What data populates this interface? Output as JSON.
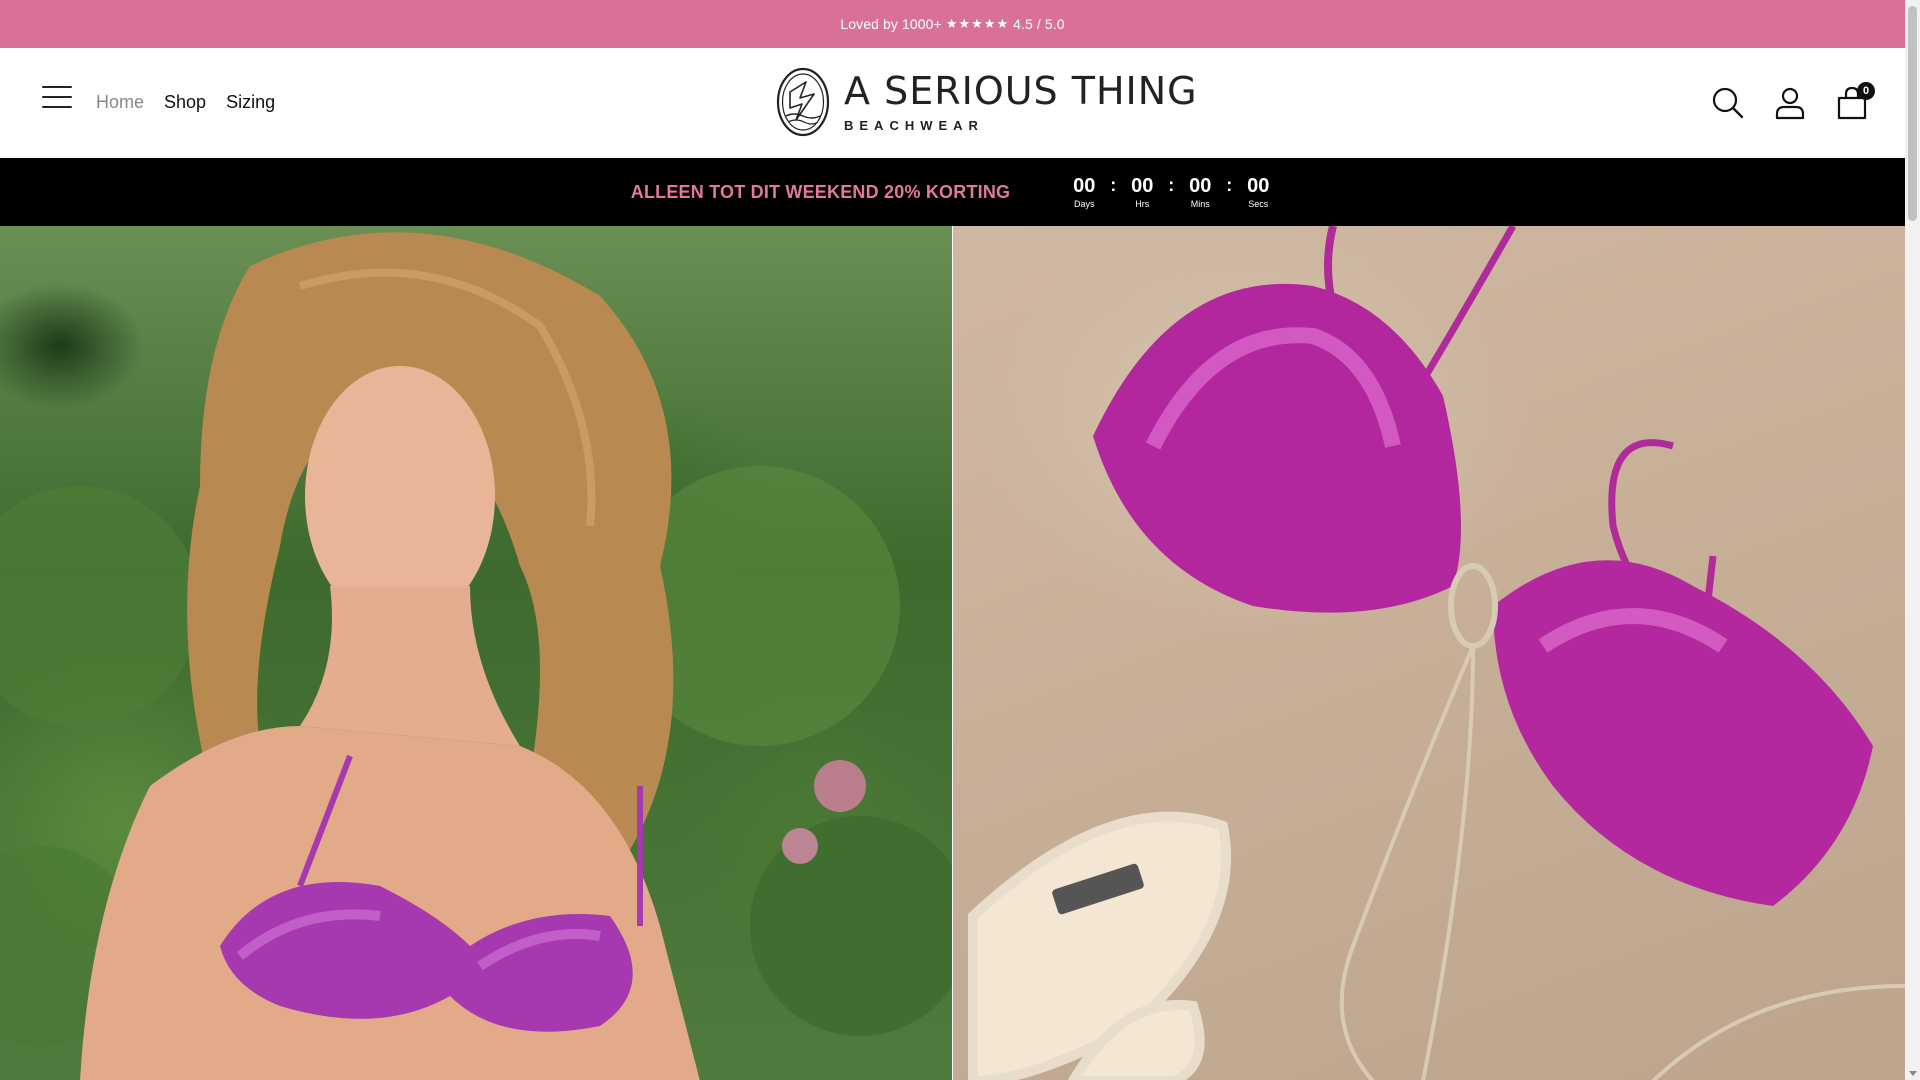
{
  "announcement": {
    "text_before": "Loved by 1000+",
    "stars": "★★★★★",
    "rating": "4.5 / 5.0"
  },
  "header": {
    "nav": [
      {
        "label": "Home",
        "active": true
      },
      {
        "label": "Shop",
        "active": false
      },
      {
        "label": "Sizing",
        "active": false
      }
    ],
    "logo": {
      "brand": "A SERIOUS THING",
      "subtitle": "BEACHWEAR"
    },
    "icons": [
      "menu-icon",
      "search-icon",
      "account-icon",
      "cart-icon"
    ],
    "cart_count": "0"
  },
  "promo": {
    "text": "ALLEEN TOT DIT WEEKEND 20% KORTING",
    "countdown": [
      {
        "value": "00",
        "label": "Days"
      },
      {
        "value": "00",
        "label": "Hrs"
      },
      {
        "value": "00",
        "label": "Mins"
      },
      {
        "value": "00",
        "label": "Secs"
      }
    ],
    "separator": ":"
  },
  "colors": {
    "announcement_bg": "#d8709a",
    "promo_text": "#e278a0",
    "promo_bg": "#000000"
  },
  "hero": {
    "left_image": "model-wearing-purple-satin-bikini-top",
    "right_image": "purple-satin-bikini-top-flatlay-with-sandals"
  }
}
